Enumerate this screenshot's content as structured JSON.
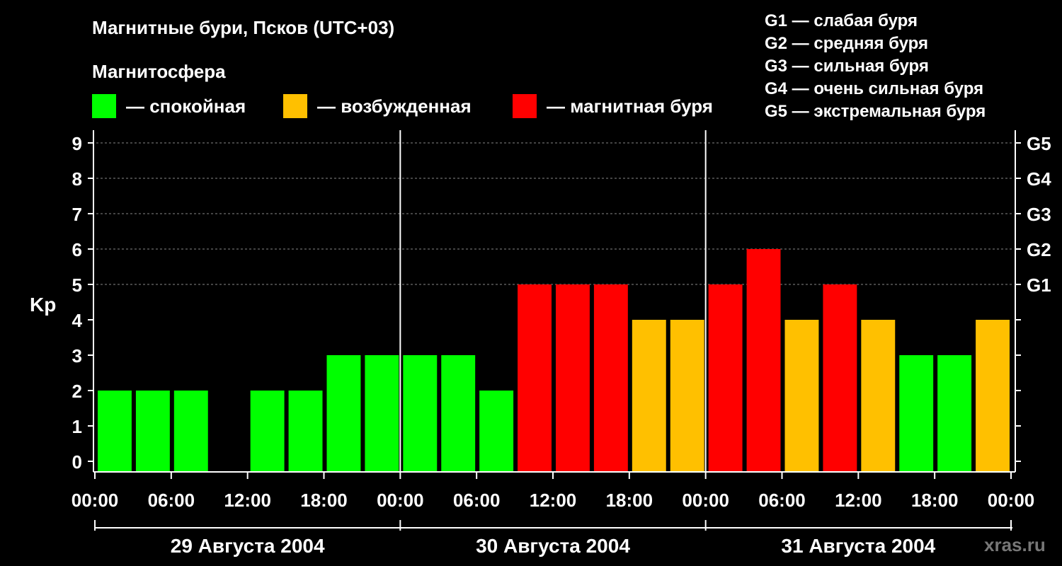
{
  "title": "Магнитные бури, Псков (UTC+03)",
  "subtitle": "Магнитосфера",
  "legend": [
    {
      "label": "— спокойная",
      "color": "#00ff00"
    },
    {
      "label": "— возбужденная",
      "color": "#ffc000"
    },
    {
      "label": "— магнитная буря",
      "color": "#ff0000"
    }
  ],
  "g_scale": [
    "G1 — слабая буря",
    "G2 — средняя буря",
    "G3 — сильная буря",
    "G4 — очень сильная буря",
    "G5 — экстремальная буря"
  ],
  "watermark": "xras.ru",
  "chart_data": {
    "type": "bar",
    "ylabel": "Kp",
    "ylim": [
      0,
      9
    ],
    "yticks": [
      "0",
      "1",
      "2",
      "3",
      "4",
      "5",
      "6",
      "7",
      "8",
      "9"
    ],
    "right_ticks": [
      {
        "kp": 5,
        "label": "G1"
      },
      {
        "kp": 6,
        "label": "G2"
      },
      {
        "kp": 7,
        "label": "G3"
      },
      {
        "kp": 8,
        "label": "G4"
      },
      {
        "kp": 9,
        "label": "G5"
      }
    ],
    "grid": true,
    "xtick_labels": [
      "00:00",
      "06:00",
      "12:00",
      "18:00",
      "00:00",
      "06:00",
      "12:00",
      "18:00",
      "00:00",
      "06:00",
      "12:00",
      "18:00",
      "00:00"
    ],
    "days": [
      "29 Августа 2004",
      "30 Августа 2004",
      "31 Августа 2004"
    ],
    "interval_hours": 3,
    "values": [
      2,
      2,
      2,
      0,
      2,
      2,
      3,
      3,
      3,
      3,
      2,
      5,
      5,
      5,
      4,
      4,
      5,
      6,
      4,
      5,
      4,
      3,
      3,
      4
    ],
    "colors": {
      "quiet": "#00ff00",
      "active": "#ffc000",
      "storm": "#ff0000"
    }
  }
}
